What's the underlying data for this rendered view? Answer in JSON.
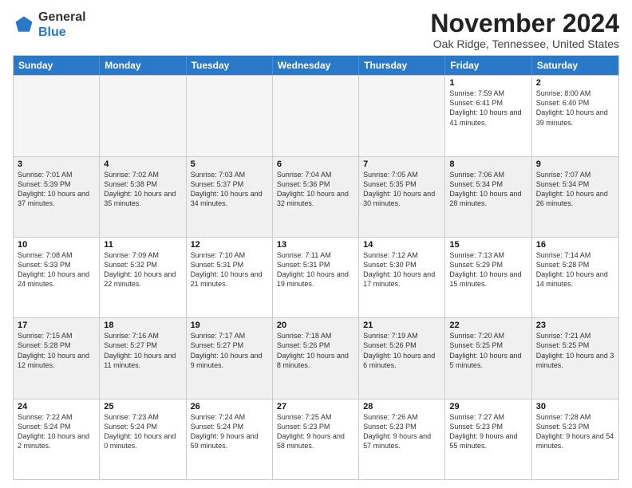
{
  "logo": {
    "general": "General",
    "blue": "Blue"
  },
  "header": {
    "month": "November 2024",
    "location": "Oak Ridge, Tennessee, United States"
  },
  "days": [
    "Sunday",
    "Monday",
    "Tuesday",
    "Wednesday",
    "Thursday",
    "Friday",
    "Saturday"
  ],
  "weeks": [
    [
      {
        "day": "",
        "empty": true
      },
      {
        "day": "",
        "empty": true
      },
      {
        "day": "",
        "empty": true
      },
      {
        "day": "",
        "empty": true
      },
      {
        "day": "",
        "empty": true
      },
      {
        "day": "1",
        "sunrise": "Sunrise: 7:59 AM",
        "sunset": "Sunset: 6:41 PM",
        "daylight": "Daylight: 10 hours and 41 minutes."
      },
      {
        "day": "2",
        "sunrise": "Sunrise: 8:00 AM",
        "sunset": "Sunset: 6:40 PM",
        "daylight": "Daylight: 10 hours and 39 minutes."
      }
    ],
    [
      {
        "day": "3",
        "sunrise": "Sunrise: 7:01 AM",
        "sunset": "Sunset: 5:39 PM",
        "daylight": "Daylight: 10 hours and 37 minutes."
      },
      {
        "day": "4",
        "sunrise": "Sunrise: 7:02 AM",
        "sunset": "Sunset: 5:38 PM",
        "daylight": "Daylight: 10 hours and 35 minutes."
      },
      {
        "day": "5",
        "sunrise": "Sunrise: 7:03 AM",
        "sunset": "Sunset: 5:37 PM",
        "daylight": "Daylight: 10 hours and 34 minutes."
      },
      {
        "day": "6",
        "sunrise": "Sunrise: 7:04 AM",
        "sunset": "Sunset: 5:36 PM",
        "daylight": "Daylight: 10 hours and 32 minutes."
      },
      {
        "day": "7",
        "sunrise": "Sunrise: 7:05 AM",
        "sunset": "Sunset: 5:35 PM",
        "daylight": "Daylight: 10 hours and 30 minutes."
      },
      {
        "day": "8",
        "sunrise": "Sunrise: 7:06 AM",
        "sunset": "Sunset: 5:34 PM",
        "daylight": "Daylight: 10 hours and 28 minutes."
      },
      {
        "day": "9",
        "sunrise": "Sunrise: 7:07 AM",
        "sunset": "Sunset: 5:34 PM",
        "daylight": "Daylight: 10 hours and 26 minutes."
      }
    ],
    [
      {
        "day": "10",
        "sunrise": "Sunrise: 7:08 AM",
        "sunset": "Sunset: 5:33 PM",
        "daylight": "Daylight: 10 hours and 24 minutes."
      },
      {
        "day": "11",
        "sunrise": "Sunrise: 7:09 AM",
        "sunset": "Sunset: 5:32 PM",
        "daylight": "Daylight: 10 hours and 22 minutes."
      },
      {
        "day": "12",
        "sunrise": "Sunrise: 7:10 AM",
        "sunset": "Sunset: 5:31 PM",
        "daylight": "Daylight: 10 hours and 21 minutes."
      },
      {
        "day": "13",
        "sunrise": "Sunrise: 7:11 AM",
        "sunset": "Sunset: 5:31 PM",
        "daylight": "Daylight: 10 hours and 19 minutes."
      },
      {
        "day": "14",
        "sunrise": "Sunrise: 7:12 AM",
        "sunset": "Sunset: 5:30 PM",
        "daylight": "Daylight: 10 hours and 17 minutes."
      },
      {
        "day": "15",
        "sunrise": "Sunrise: 7:13 AM",
        "sunset": "Sunset: 5:29 PM",
        "daylight": "Daylight: 10 hours and 15 minutes."
      },
      {
        "day": "16",
        "sunrise": "Sunrise: 7:14 AM",
        "sunset": "Sunset: 5:28 PM",
        "daylight": "Daylight: 10 hours and 14 minutes."
      }
    ],
    [
      {
        "day": "17",
        "sunrise": "Sunrise: 7:15 AM",
        "sunset": "Sunset: 5:28 PM",
        "daylight": "Daylight: 10 hours and 12 minutes."
      },
      {
        "day": "18",
        "sunrise": "Sunrise: 7:16 AM",
        "sunset": "Sunset: 5:27 PM",
        "daylight": "Daylight: 10 hours and 11 minutes."
      },
      {
        "day": "19",
        "sunrise": "Sunrise: 7:17 AM",
        "sunset": "Sunset: 5:27 PM",
        "daylight": "Daylight: 10 hours and 9 minutes."
      },
      {
        "day": "20",
        "sunrise": "Sunrise: 7:18 AM",
        "sunset": "Sunset: 5:26 PM",
        "daylight": "Daylight: 10 hours and 8 minutes."
      },
      {
        "day": "21",
        "sunrise": "Sunrise: 7:19 AM",
        "sunset": "Sunset: 5:26 PM",
        "daylight": "Daylight: 10 hours and 6 minutes."
      },
      {
        "day": "22",
        "sunrise": "Sunrise: 7:20 AM",
        "sunset": "Sunset: 5:25 PM",
        "daylight": "Daylight: 10 hours and 5 minutes."
      },
      {
        "day": "23",
        "sunrise": "Sunrise: 7:21 AM",
        "sunset": "Sunset: 5:25 PM",
        "daylight": "Daylight: 10 hours and 3 minutes."
      }
    ],
    [
      {
        "day": "24",
        "sunrise": "Sunrise: 7:22 AM",
        "sunset": "Sunset: 5:24 PM",
        "daylight": "Daylight: 10 hours and 2 minutes."
      },
      {
        "day": "25",
        "sunrise": "Sunrise: 7:23 AM",
        "sunset": "Sunset: 5:24 PM",
        "daylight": "Daylight: 10 hours and 0 minutes."
      },
      {
        "day": "26",
        "sunrise": "Sunrise: 7:24 AM",
        "sunset": "Sunset: 5:24 PM",
        "daylight": "Daylight: 9 hours and 59 minutes."
      },
      {
        "day": "27",
        "sunrise": "Sunrise: 7:25 AM",
        "sunset": "Sunset: 5:23 PM",
        "daylight": "Daylight: 9 hours and 58 minutes."
      },
      {
        "day": "28",
        "sunrise": "Sunrise: 7:26 AM",
        "sunset": "Sunset: 5:23 PM",
        "daylight": "Daylight: 9 hours and 57 minutes."
      },
      {
        "day": "29",
        "sunrise": "Sunrise: 7:27 AM",
        "sunset": "Sunset: 5:23 PM",
        "daylight": "Daylight: 9 hours and 55 minutes."
      },
      {
        "day": "30",
        "sunrise": "Sunrise: 7:28 AM",
        "sunset": "Sunset: 5:23 PM",
        "daylight": "Daylight: 9 hours and 54 minutes."
      }
    ]
  ]
}
